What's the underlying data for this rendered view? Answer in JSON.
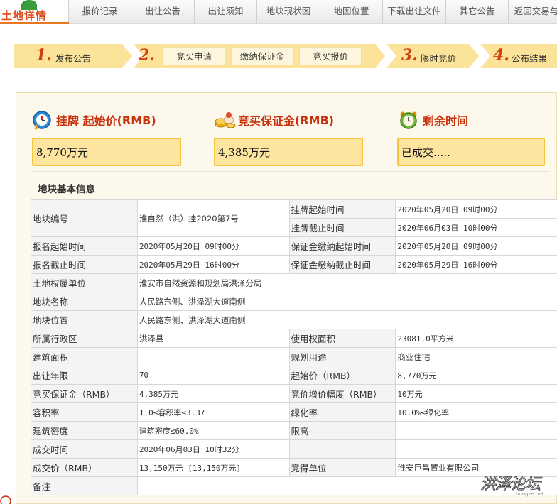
{
  "header": {
    "logo_text": "土地详情",
    "tabs": [
      "报价记录",
      "出让公告",
      "出让须知",
      "地块现状图",
      "地图位置",
      "下载出让文件",
      "其它公告",
      "返回交易与"
    ]
  },
  "steps": {
    "s1_num": "1.",
    "s1_label": "发布公告",
    "s2_num": "2.",
    "s2_buttons": [
      "竞买申请",
      "缴纳保证金",
      "竞买报价"
    ],
    "s3_num": "3.",
    "s3_label": "限时竞价",
    "s4_num": "4.",
    "s4_label": "公布结果"
  },
  "summary": {
    "price_title": "挂牌  起始价",
    "price_unit": "(RMB)",
    "price_value": "8,770万元",
    "deposit_title": "竞买保证金",
    "deposit_unit": "(RMB)",
    "deposit_value": "4,385万元",
    "remain_title": "剩余时间",
    "remain_value": "已成交....."
  },
  "section_title": "地块基本信息",
  "table": {
    "r1": {
      "l1": "地块编号",
      "v1": "淮自然（洪）挂2020第7号",
      "l2a": "挂牌起始时间",
      "v2a": "2020年05月20日 09时00分",
      "l2b": "挂牌截止时间",
      "v2b": "2020年06月03日 10时00分"
    },
    "r2": {
      "l1": "报名起始时间",
      "v1": "2020年05月20日 09时00分",
      "l2": "保证金缴纳起始时间",
      "v2": "2020年05月20日 09时00分"
    },
    "r3": {
      "l1": "报名截止时间",
      "v1": "2020年05月29日 16时00分",
      "l2": "保证金缴纳截止时间",
      "v2": "2020年05月29日 16时00分"
    },
    "r4": {
      "l1": "土地权属单位",
      "v1": "淮安市自然资源和规划局洪泽分局"
    },
    "r5": {
      "l1": "地块名称",
      "v1": "人民路东侧、洪泽湖大道南侧"
    },
    "r6": {
      "l1": "地块位置",
      "v1": "人民路东侧、洪泽湖大道南侧"
    },
    "r7": {
      "l1": "所属行政区",
      "v1": "洪泽县",
      "l2": "使用权面积",
      "v2": "23081.0平方米"
    },
    "r8": {
      "l1": "建筑面积",
      "v1": "",
      "l2": "规划用途",
      "v2": "商业住宅"
    },
    "r9": {
      "l1": "出让年限",
      "v1": "70",
      "l2": "起始价（RMB）",
      "v2": "8,770万元"
    },
    "r10": {
      "l1": "竞买保证金（RMB）",
      "v1": "4,385万元",
      "l2": "竞价增价幅度（RMB）",
      "v2": "10万元"
    },
    "r11": {
      "l1": "容积率",
      "v1": "1.0≤容积率≤3.37",
      "l2": "绿化率",
      "v2": "10.0%≤绿化率"
    },
    "r12": {
      "l1": "建筑密度",
      "v1": "建筑密度≤60.0%",
      "l2": "限高",
      "v2": ""
    },
    "r13": {
      "l1": "成交时间",
      "v1": "2020年06月03日 10时32分"
    },
    "r14": {
      "l1": "成交价（RMB）",
      "v1": "13,150万元 [13,150万元]",
      "l2": "竞得单位",
      "v2": "淮安巨昌置业有限公司"
    },
    "r15": {
      "l1": "备注",
      "v1": ""
    }
  },
  "watermark": {
    "text": "洪泽论坛",
    "url": "hongze.net"
  },
  "colors": {
    "accent": "#c8320c",
    "step_bg": "#fbe39a",
    "box_bg": "#fde5a0",
    "box_border": "#f5c542",
    "panel_bg": "#fdf8ec"
  }
}
